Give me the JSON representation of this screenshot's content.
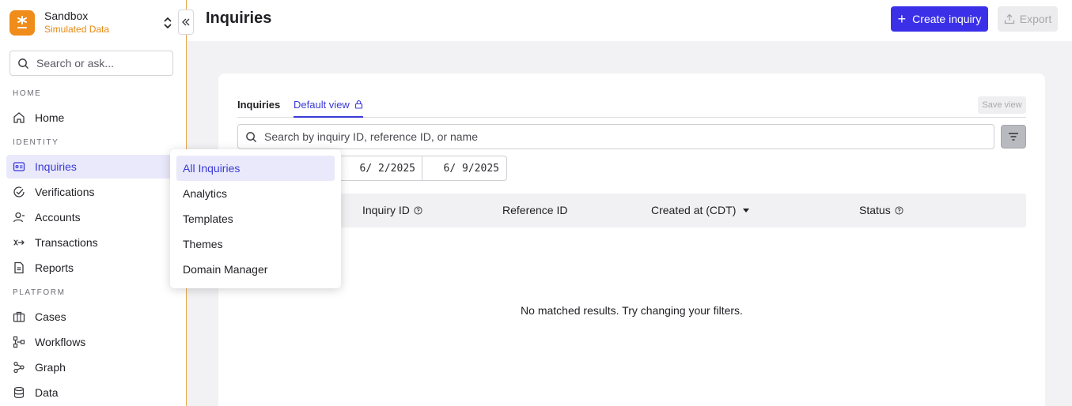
{
  "workspace": {
    "name": "Sandbox",
    "subtitle": "Simulated Data"
  },
  "sidebar": {
    "search_placeholder": "Search or ask...",
    "sections": {
      "home": "HOME",
      "identity": "IDENTITY",
      "platform": "PLATFORM"
    },
    "items": {
      "home": "Home",
      "inquiries": "Inquiries",
      "verifications": "Verifications",
      "accounts": "Accounts",
      "transactions": "Transactions",
      "reports": "Reports",
      "cases": "Cases",
      "workflows": "Workflows",
      "graph": "Graph",
      "data": "Data"
    }
  },
  "header": {
    "title": "Inquiries",
    "create_label": "Create inquiry",
    "export_label": "Export"
  },
  "main": {
    "tabs": {
      "inquiries": "Inquiries",
      "default_view": "Default view"
    },
    "save_view_label": "Save view",
    "search_placeholder": "Search by inquiry ID, reference ID, or name",
    "date_from": "6/ 2/2025",
    "date_to": "6/ 9/2025",
    "columns": {
      "inquiry_id": "Inquiry ID",
      "reference_id": "Reference ID",
      "created_at": "Created at (CDT)",
      "status": "Status"
    },
    "empty_message": "No matched results. Try changing your filters."
  },
  "dropdown": {
    "items": [
      "All Inquiries",
      "Analytics",
      "Templates",
      "Themes",
      "Domain Manager"
    ],
    "selected": "All Inquiries"
  },
  "colors": {
    "accent": "#3b30e8",
    "brand": "#f08c1a",
    "active_bg": "#e9e9fb"
  }
}
